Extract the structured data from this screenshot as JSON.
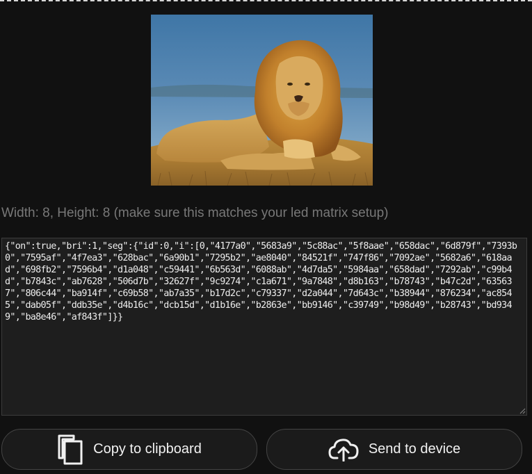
{
  "preview": {
    "image": "lion-photo"
  },
  "info": {
    "text": "Width: 8, Height: 8 (make sure this matches your led matrix setup)"
  },
  "output": {
    "json_text": "{\"on\":true,\"bri\":1,\"seg\":{\"id\":0,\"i\":[0,\"4177a0\",\"5683a9\",\"5c88ac\",\"5f8aae\",\"658dac\",\"6d879f\",\"7393b0\",\"7595af\",\"4f7ea3\",\"628bac\",\"6a90b1\",\"7295b2\",\"ae8040\",\"84521f\",\"747f86\",\"7092ae\",\"5682a6\",\"618aad\",\"698fb2\",\"7596b4\",\"d1a048\",\"c59441\",\"6b563d\",\"6088ab\",\"4d7da5\",\"5984aa\",\"658dad\",\"7292ab\",\"c99b4d\",\"b7843c\",\"ab7628\",\"506d7b\",\"32627f\",\"9c9274\",\"c1a671\",\"9a7848\",\"d8b163\",\"b78743\",\"b47c2d\",\"635637\",\"806c44\",\"ba914f\",\"c69b58\",\"ab7a35\",\"b17d2c\",\"c79337\",\"d2a044\",\"7d643c\",\"b38944\",\"876234\",\"ac8545\",\"dab05f\",\"ddb35e\",\"d4b16c\",\"dcb15d\",\"d1b16e\",\"b2863e\",\"bb9146\",\"c39749\",\"b98d49\",\"b28743\",\"bd9349\",\"ba8e46\",\"af843f\"]}}"
  },
  "buttons": {
    "copy": {
      "label": "Copy to clipboard",
      "icon": "copy-icon"
    },
    "send": {
      "label": "Send to device",
      "icon": "cloud-upload-icon"
    }
  }
}
